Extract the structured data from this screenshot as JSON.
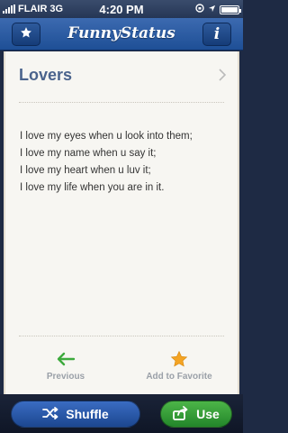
{
  "status_bar": {
    "carrier": "FLAIR",
    "network": "3G",
    "time": "4:20 PM"
  },
  "nav": {
    "title": "FunnyStatus",
    "info_label": "i"
  },
  "card": {
    "category": "Lovers",
    "lines": [
      "I love my eyes when u look into them;",
      "I love my name when u say it;",
      "I love my heart when u luv it;",
      "I love my life when you are in it."
    ],
    "previous_label": "Previous",
    "favorite_label": "Add to Favorite"
  },
  "bottom_bar": {
    "shuffle_label": "Shuffle",
    "use_label": "Use"
  },
  "colors": {
    "nav_blue": "#2b5ba3",
    "card_bg": "#f7f6f2",
    "category_text": "#4a638c",
    "previous_arrow": "#3daa3d",
    "favorite_star": "#f4a424",
    "shuffle_button": "#2d5fb0",
    "use_button": "#3aa53a"
  },
  "icons": {
    "nav_left": "star-icon",
    "nav_right": "info-icon",
    "previous": "arrow-left-icon",
    "favorite": "star-icon",
    "shuffle": "shuffle-icon",
    "use": "share-icon"
  }
}
